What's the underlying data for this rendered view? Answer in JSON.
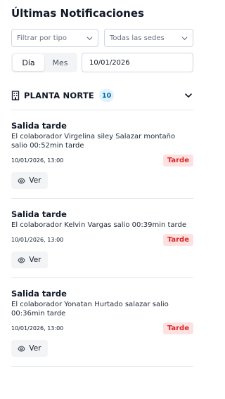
{
  "page_title": "Últimas Notificaciones",
  "filters": {
    "type_select": "Filtrar por tipo",
    "site_select": "Todas las sedes"
  },
  "period_toggle": {
    "day_label": "Día",
    "month_label": "Mes",
    "selected": "Día"
  },
  "date_input": {
    "value": "10/01/2026"
  },
  "group": {
    "title": "PLANTA NORTE",
    "count": "10",
    "icon": "building-icon",
    "expanded": true
  },
  "notifications": [
    {
      "title": "Salida tarde",
      "message": "El colaborador Virgelina siley Salazar montaño salio 00:52min tarde",
      "time": "10/01/2026, 13:00",
      "tag": "Tarde",
      "action": "Ver"
    },
    {
      "title": "Salida tarde",
      "message": "El colaborador Kelvin Vargas salio 00:39min tarde",
      "time": "10/01/2026, 13:00",
      "tag": "Tarde",
      "action": "Ver"
    },
    {
      "title": "Salida tarde",
      "message": "El colaborador Yonatan Hurtado salazar salio 00:36min tarde",
      "time": "10/01/2026, 13:00",
      "tag": "Tarde",
      "action": "Ver"
    }
  ],
  "colors": {
    "tag_bg": "#fee2e2",
    "tag_text": "#dc2626",
    "badge_bg": "#e0f2fe",
    "badge_text": "#0369a1"
  }
}
